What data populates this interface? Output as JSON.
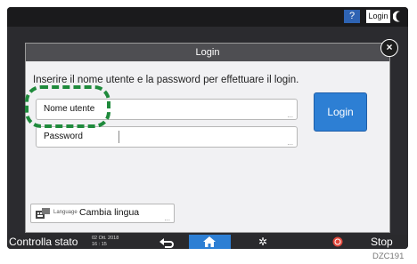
{
  "topbar": {
    "help_label": "?",
    "login_label": "Login"
  },
  "dialog": {
    "title": "Login",
    "close_label": "×",
    "instruction": "Inserire il nome utente e la password per effettuare il login.",
    "username_label": "Nome utente",
    "password_label": "Password",
    "field_more": "...",
    "login_button_label": "Login",
    "language_small": "Language",
    "language_label": "Cambia lingua",
    "language_more": "..."
  },
  "bottombar": {
    "status_label": "Controlla stato",
    "date": "02 Ott. 2018",
    "time": "16 : 15",
    "stop_label": "Stop"
  },
  "figure_code": "DZC191",
  "colors": {
    "accent": "#2d7fd4",
    "highlight": "#1f8a3c",
    "stop": "#e0473a"
  }
}
